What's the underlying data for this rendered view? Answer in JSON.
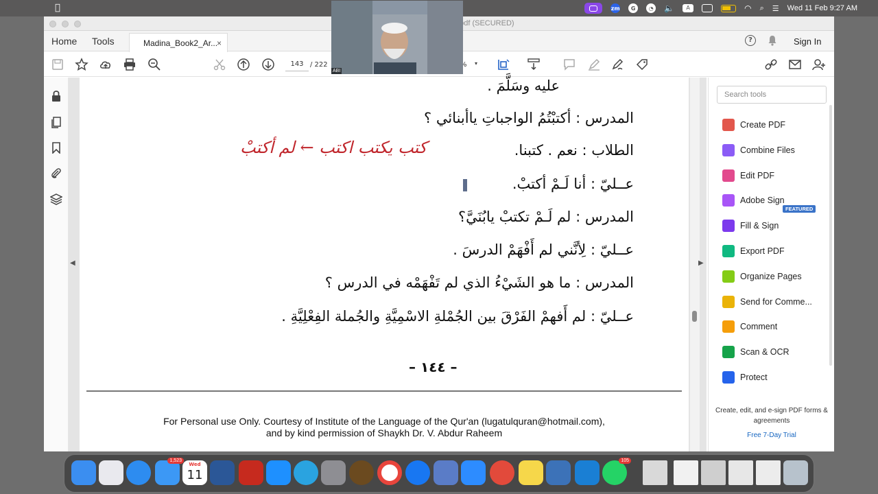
{
  "menubar": {
    "zoom_label": "zm",
    "key_label": "A",
    "datetime": "Wed 11 Feb  9:27 AM"
  },
  "window": {
    "title_fragment": "t.pdf (SECURED)"
  },
  "tabs": {
    "home": "Home",
    "tools": "Tools",
    "doc_tab": "Madina_Book2_Ar...",
    "close": "×",
    "help": "?",
    "sign_in": "Sign In"
  },
  "toolbar": {
    "page_current": "143",
    "page_total": "/  222",
    "zoom_fragment": "%"
  },
  "document": {
    "lines": [
      "عليه وسَلَّمَ .",
      "المدرس  :  أكتبْتُمُ الواجباتِ ياأبنائي ؟",
      "الطلاب :  نعم . كتبنا.",
      "عــليّ   :  أنا لَـمْ أكتبْ.",
      "المدرس  :  لم لَـمْ تكتبْ يابُنَيَّ؟",
      "عــليّ   :  لِأنَّني لم أَفْهَمْ الدرسَ .",
      "المدرس  :  ما هو الشَيْءُ الذي لم تَفْهَمْه في الدرس ؟",
      "عــليّ   :  لم أَفهمْ الفَرْقَ بين الجُمْلةِ الاسْمِيَّةِ والجُملة الفِعْلِيَّةِ ."
    ],
    "handwriting": "كتب  يكتب  اكتب  ← لم أكتبْ",
    "page_number": "– ١٤٤ –",
    "footer_line1": "For Personal use Only. Courtesy of Institute of the Language of the Qur'an (lugatulquran@hotmail.com),",
    "footer_line2": "and by kind permission of Shaykh Dr. V. Abdur Raheem"
  },
  "right_panel": {
    "search_placeholder": "Search tools",
    "tools": [
      {
        "label": "Create PDF",
        "color": "#e2574c"
      },
      {
        "label": "Combine Files",
        "color": "#8b5cf6"
      },
      {
        "label": "Edit PDF",
        "color": "#e24a8d"
      },
      {
        "label": "Adobe Sign",
        "color": "#a855f7"
      },
      {
        "label": "Fill & Sign",
        "color": "#7c3aed"
      },
      {
        "label": "Export PDF",
        "color": "#10b981"
      },
      {
        "label": "Organize Pages",
        "color": "#84cc16"
      },
      {
        "label": "Send for Comme...",
        "color": "#eab308"
      },
      {
        "label": "Comment",
        "color": "#f59e0b"
      },
      {
        "label": "Scan & OCR",
        "color": "#16a34a"
      },
      {
        "label": "Protect",
        "color": "#2563eb"
      }
    ],
    "featured_badge": "FEATURED",
    "promo_text": "Create, edit, and e-sign PDF forms & agreements",
    "trial_link": "Free 7-Day Trial"
  },
  "video": {
    "label": "ABI"
  },
  "dock": {
    "mail_badge": "1,523",
    "calendar_day": "Wed",
    "calendar_num": "11",
    "whatsapp_badge": "105"
  }
}
